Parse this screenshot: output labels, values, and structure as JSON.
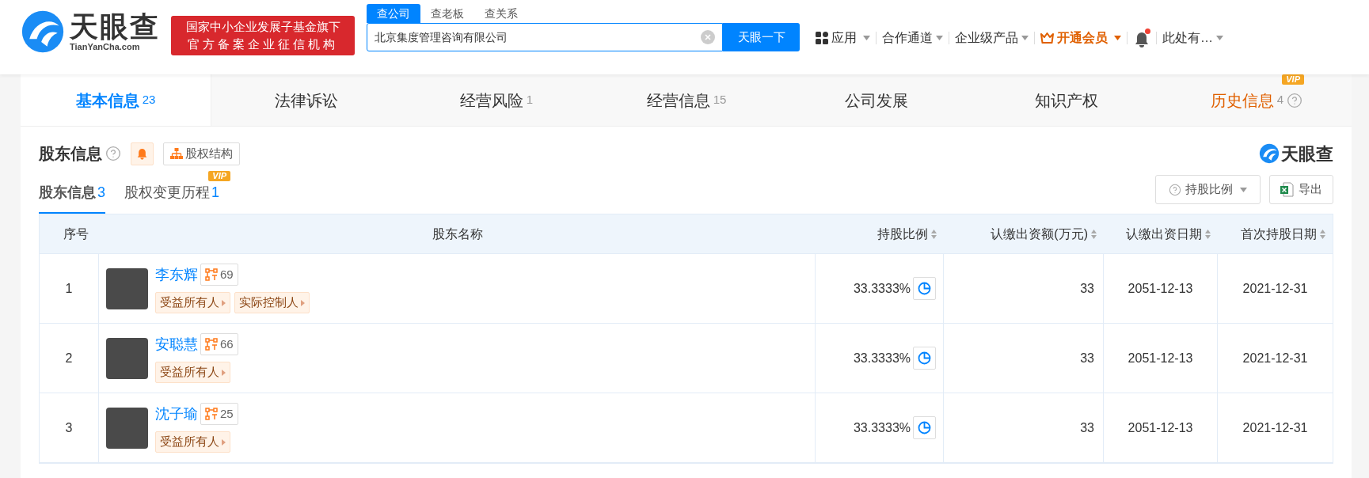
{
  "header": {
    "logo": {
      "name": "天眼查",
      "domain": "TianYanCha.com"
    },
    "tagline": [
      "国家中小企业发展子基金旗下",
      "官方备案企业征信机构"
    ],
    "search_tabs": [
      {
        "label": "查公司",
        "selected": true
      },
      {
        "label": "查老板",
        "selected": false
      },
      {
        "label": "查关系",
        "selected": false
      }
    ],
    "search": {
      "value": "北京集度管理咨询有限公司",
      "button": "天眼一下"
    },
    "nav": [
      {
        "kind": "apps",
        "label": "应用"
      },
      {
        "kind": "plain",
        "label": "合作通道"
      },
      {
        "kind": "plain",
        "label": "企业级产品"
      },
      {
        "kind": "vip",
        "label": "开通会员"
      },
      {
        "kind": "bell",
        "unread": true
      },
      {
        "kind": "plain",
        "label": "此处有…"
      }
    ]
  },
  "main_tabs": [
    {
      "label": "基本信息",
      "count": "23",
      "selected": true,
      "vip": false
    },
    {
      "label": "法律诉讼",
      "selected": false,
      "vip": false
    },
    {
      "label": "经营风险",
      "count": "1",
      "selected": false,
      "vip": false
    },
    {
      "label": "经营信息",
      "count": "15",
      "selected": false,
      "vip": false
    },
    {
      "label": "公司发展",
      "selected": false,
      "vip": false
    },
    {
      "label": "知识产权",
      "selected": false,
      "vip": false
    },
    {
      "label": "历史信息",
      "count": "4",
      "selected": false,
      "vip": true,
      "badge": "VIP"
    }
  ],
  "section": {
    "title": "股东信息",
    "structure_button": "股权结构",
    "brand": "天眼查",
    "sub_tabs": [
      {
        "label": "股东信息",
        "count": "3",
        "selected": true
      },
      {
        "label": "股权变更历程",
        "count": "1",
        "selected": false,
        "badge": "VIP"
      }
    ],
    "ratio_button": "持股比例",
    "export_button": "导出"
  },
  "table": {
    "columns": [
      {
        "label": "序号",
        "sortable": false
      },
      {
        "label": "股东名称",
        "sortable": false
      },
      {
        "label": "持股比例",
        "sortable": true
      },
      {
        "label": "认缴出资额(万元)",
        "sortable": true
      },
      {
        "label": "认缴出资日期",
        "sortable": true
      },
      {
        "label": "首次持股日期",
        "sortable": true
      }
    ],
    "rows": [
      {
        "index": "1",
        "name": "李东辉",
        "related": "69",
        "tags": [
          "受益所有人",
          "实际控制人"
        ],
        "ratio": "33.3333%",
        "amount": "33",
        "subscribed_date": "2051-12-13",
        "first_date": "2021-12-31"
      },
      {
        "index": "2",
        "name": "安聪慧",
        "related": "66",
        "tags": [
          "受益所有人"
        ],
        "ratio": "33.3333%",
        "amount": "33",
        "subscribed_date": "2051-12-13",
        "first_date": "2021-12-31"
      },
      {
        "index": "3",
        "name": "沈子瑜",
        "related": "25",
        "tags": [
          "受益所有人"
        ],
        "ratio": "33.3333%",
        "amount": "33",
        "subscribed_date": "2051-12-13",
        "first_date": "2021-12-31"
      }
    ]
  }
}
